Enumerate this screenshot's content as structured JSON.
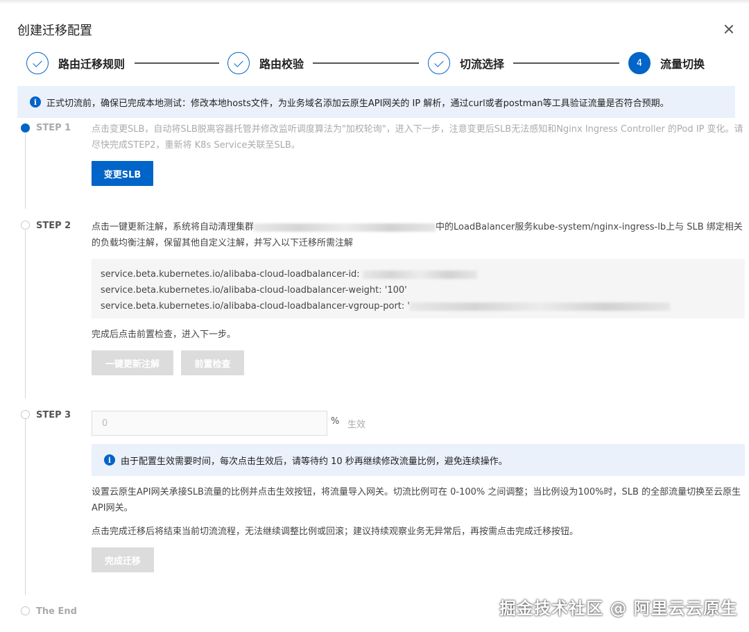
{
  "dialog": {
    "title": "创建迁移配置"
  },
  "steps": [
    {
      "label": "路由迁移规则",
      "status": "done"
    },
    {
      "label": "路由校验",
      "status": "done"
    },
    {
      "label": "切流选择",
      "status": "done"
    },
    {
      "label": "流量切换",
      "status": "active",
      "number": "4"
    }
  ],
  "notice": {
    "text": "正式切流前，确保已完成本地测试：修改本地hosts文件，为业务域名添加云原生API网关的 IP 解析，通过curl或者postman等工具验证流量是否符合预期。"
  },
  "step1": {
    "label": "STEP 1",
    "description": "点击变更SLB，自动将SLB脱离容器托管并修改监听调度算法为\"加权轮询\"，进入下一步，注意变更后SLB无法感知和Nginx Ingress Controller 的Pod IP 变化。请尽快完成STEP2，重新将 K8s Service关联至SLB。",
    "button": "变更SLB"
  },
  "step2": {
    "label": "STEP 2",
    "desc_before": "点击一键更新注解，系统将自动清理集群",
    "desc_after": "中的LoadBalancer服务kube-system/nginx-ingress-lb上与 SLB 绑定相关的负载均衡注解，保留其他自定义注解，并写入以下迁移所需注解",
    "annotations": {
      "id_key": "service.beta.kubernetes.io/alibaba-cloud-loadbalancer-id:",
      "weight_line": "service.beta.kubernetes.io/alibaba-cloud-loadbalancer-weight: '100'",
      "vgroup_key": "service.beta.kubernetes.io/alibaba-cloud-loadbalancer-vgroup-port: '"
    },
    "after_text": "完成后点击前置检查，进入下一步。",
    "update_button": "一键更新注解",
    "check_button": "前置检查"
  },
  "step3": {
    "label": "STEP 3",
    "percent_value": "0",
    "percent_sign": "%",
    "apply_label": "生效",
    "notice": "由于配置生效需要时间，每次点击生效后，请等待约 10 秒再继续修改流量比例，避免连续操作。",
    "desc1": "设置云原生API网关承接SLB流量的比例并点击生效按钮，将流量导入网关。切流比例可在 0-100% 之间调整；当比例设为100%时，SLB 的全部流量切换至云原生API网关。",
    "desc2": "点击完成迁移后将结束当前切流流程，无法继续调整比例或回滚；建议持续观察业务无异常后，再按需点击完成迁移按钮。",
    "finish_button": "完成迁移"
  },
  "end": {
    "label": "The End"
  },
  "watermark": "掘金技术社区 @ 阿里云云原生",
  "colors": {
    "accent": "#0064c8",
    "notice_bg": "#eaf1fa",
    "disabled": "#dcdcdc"
  }
}
